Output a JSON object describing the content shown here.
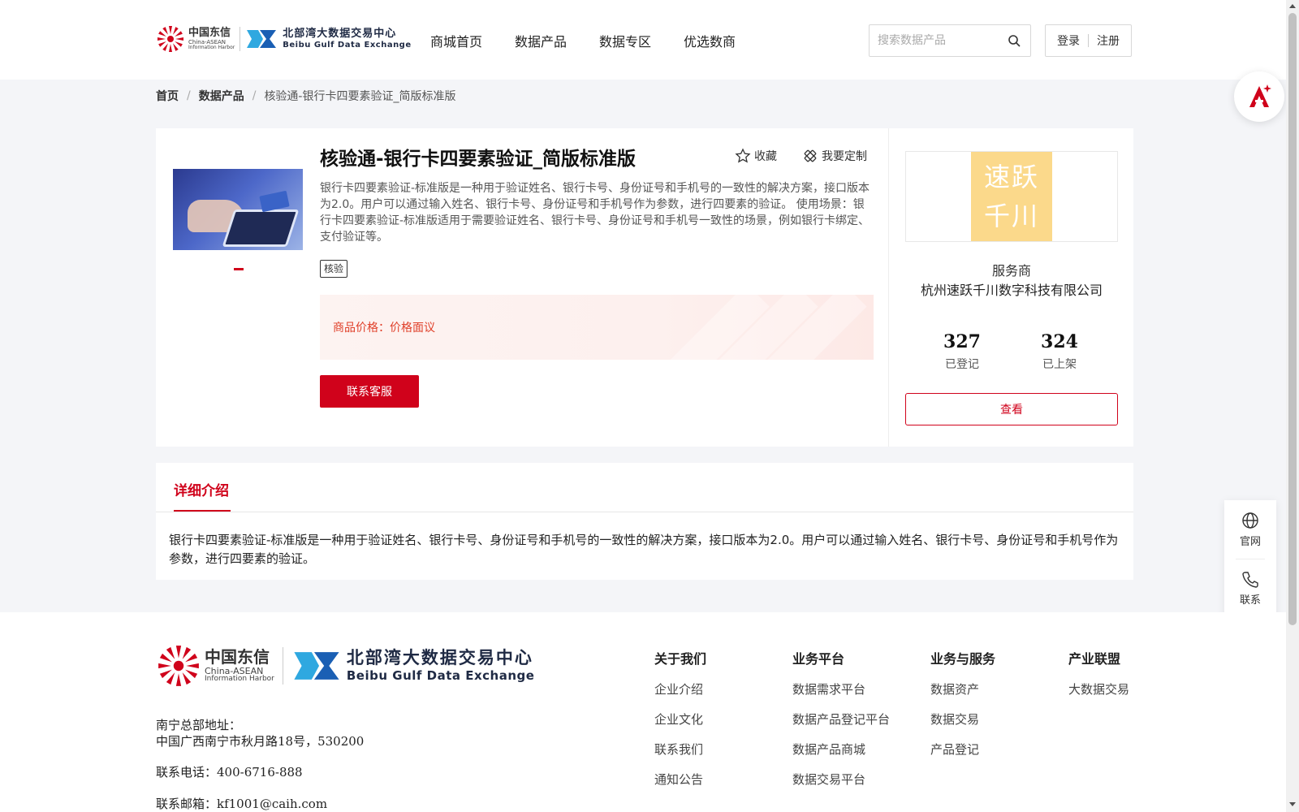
{
  "header": {
    "logo_cn": "中国东信",
    "logo_en_1": "China-ASEAN",
    "logo_en_2": "Information Harbor",
    "bb_cn": "北部湾大数据交易中心",
    "bb_en": "Beibu Gulf Data Exchange",
    "nav": [
      "商城首页",
      "数据产品",
      "数据专区",
      "优选数商"
    ],
    "search_placeholder": "搜索数据产品",
    "login_label": "登录",
    "register_label": "注册"
  },
  "breadcrumb": {
    "home": "首页",
    "category": "数据产品",
    "current": "核验通-银行卡四要素验证_简版标准版",
    "separator": "/"
  },
  "product": {
    "title": "核验通-银行卡四要素验证_简版标准版",
    "favorite_label": "收藏",
    "customize_label": "我要定制",
    "description": "银行卡四要素验证-标准版是一种用于验证姓名、银行卡号、身份证号和手机号的一致性的解决方案，接口版本为2.0。用户可以通过输入姓名、银行卡号、身份证号和手机号作为参数，进行四要素的验证。 使用场景：银行卡四要素验证-标准版适用于需要验证姓名、银行卡号、身份证号和手机号一致性的场景，例如银行卡绑定、支付验证等。",
    "tag": "核验",
    "price_label": "商品价格：",
    "price_value": "价格面议",
    "contact_button": "联系客服"
  },
  "provider": {
    "logo_line1": "速跃",
    "logo_line2": "千川",
    "role": "服务商",
    "name": "杭州速跃千川数字科技有限公司",
    "registered_count": "327",
    "registered_label": "已登记",
    "listed_count": "324",
    "listed_label": "已上架",
    "view_button": "查看"
  },
  "detail": {
    "tab_label": "详细介绍",
    "text": "银行卡四要素验证-标准版是一种用于验证姓名、银行卡号、身份证号和手机号的一致性的解决方案，接口版本为2.0。用户可以通过输入姓名、银行卡号、身份证号和手机号作为参数，进行四要素的验证。"
  },
  "side_tools": {
    "website_label": "官网",
    "contact_label": "联系"
  },
  "footer": {
    "address_label": "南宁总部地址：",
    "address": "中国广西南宁市秋月路18号，530200",
    "phone": "联系电话：400-6716-888",
    "email": "联系邮箱：kf1001@caih.com",
    "columns": [
      {
        "title": "关于我们",
        "links": [
          "企业介绍",
          "企业文化",
          "联系我们",
          "通知公告"
        ]
      },
      {
        "title": "业务平台",
        "links": [
          "数据需求平台",
          "数据产品登记平台",
          "数据产品商城",
          "数据交易平台"
        ]
      },
      {
        "title": "业务与服务",
        "links": [
          "数据资产",
          "数据交易",
          "产品登记"
        ]
      },
      {
        "title": "产业联盟",
        "links": [
          "大数据交易"
        ]
      }
    ]
  },
  "colors": {
    "accent": "#d0021b",
    "price": "#e0402a",
    "provider_logo_bg": "#fbd98b"
  }
}
